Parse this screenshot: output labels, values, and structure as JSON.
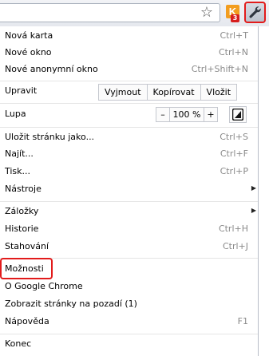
{
  "toolbar": {
    "extension_letter": "K",
    "extension_badge": "3",
    "extension_color": "#f29d1f",
    "icons": [
      "star-icon",
      "wrench-icon"
    ]
  },
  "menu": {
    "new_tab": {
      "label": "Nová karta",
      "shortcut": "Ctrl+T"
    },
    "new_window": {
      "label": "Nové okno",
      "shortcut": "Ctrl+N"
    },
    "new_incognito": {
      "label": "Nové anonymní okno",
      "shortcut": "Ctrl+Shift+N"
    },
    "edit": {
      "label": "Upravit",
      "cut": "Vyjmout",
      "copy": "Kopírovat",
      "paste": "Vložit"
    },
    "zoom": {
      "label": "Lupa",
      "minus": "–",
      "value": "100 %",
      "plus": "+"
    },
    "save_page": {
      "label": "Uložit stránku jako...",
      "shortcut": "Ctrl+S"
    },
    "find": {
      "label": "Najít...",
      "shortcut": "Ctrl+F"
    },
    "print": {
      "label": "Tisk...",
      "shortcut": "Ctrl+P"
    },
    "tools": {
      "label": "Nástroje"
    },
    "bookmarks": {
      "label": "Záložky"
    },
    "history": {
      "label": "Historie",
      "shortcut": "Ctrl+H"
    },
    "downloads": {
      "label": "Stahování",
      "shortcut": "Ctrl+J"
    },
    "options": {
      "label": "Možnosti"
    },
    "about": {
      "label": "O  Google Chrome"
    },
    "background_pages": {
      "label": "Zobrazit stránky na pozadí (1)"
    },
    "help": {
      "label": "Nápověda",
      "shortcut": "F1"
    },
    "exit": {
      "label": "Konec"
    }
  },
  "highlight_color": "#e21b1b"
}
